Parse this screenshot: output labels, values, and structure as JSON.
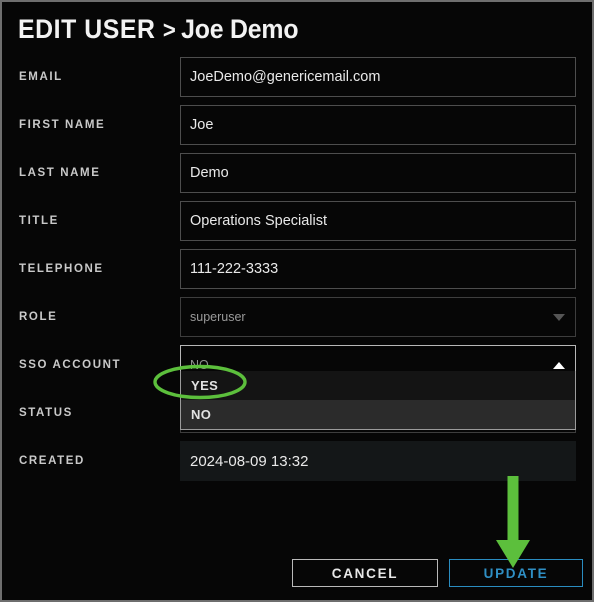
{
  "header": {
    "breadcrumb_root": "EDIT USER",
    "breadcrumb_separator": ">",
    "breadcrumb_current": "Joe Demo"
  },
  "form": {
    "fields": [
      {
        "label": "EMAIL",
        "value": "JoeDemo@genericemail.com",
        "type": "text"
      },
      {
        "label": "FIRST NAME",
        "value": "Joe",
        "type": "text"
      },
      {
        "label": "LAST NAME",
        "value": "Demo",
        "type": "text"
      },
      {
        "label": "TITLE",
        "value": "Operations Specialist",
        "type": "text"
      },
      {
        "label": "TELEPHONE",
        "value": "111-222-3333",
        "type": "text"
      },
      {
        "label": "ROLE",
        "value": "superuser",
        "type": "select"
      },
      {
        "label": "SSO ACCOUNT",
        "value": "NO",
        "type": "select-open"
      },
      {
        "label": "STATUS",
        "value": "",
        "type": "select"
      },
      {
        "label": "CREATED",
        "value": "2024-08-09 13:32",
        "type": "readonly"
      }
    ]
  },
  "sso_dropdown": {
    "selected": "NO",
    "options": [
      {
        "label": "YES",
        "highlighted": false
      },
      {
        "label": "NO",
        "highlighted": true
      }
    ]
  },
  "footer": {
    "cancel_label": "CANCEL",
    "update_label": "UPDATE"
  },
  "annotations": {
    "ellipse_target": "YES",
    "arrow_target": "UPDATE",
    "color": "#5cbf3c"
  },
  "colors": {
    "background": "#060606",
    "border": "#6e6e6e",
    "input_border": "#4d4d4d",
    "label_text": "#c9c9c9",
    "input_text": "#e9e9e9",
    "muted_text": "#9a9a9a",
    "accent_blue": "#2f8fc4",
    "annotation_green": "#5cbf3c",
    "option_highlight": "#2b2b2b"
  }
}
